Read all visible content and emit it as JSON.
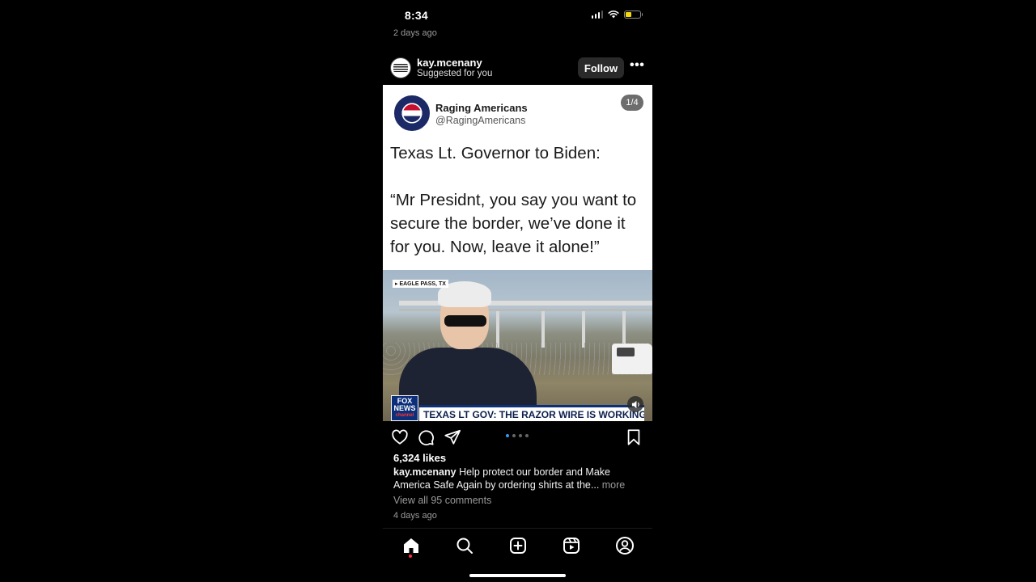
{
  "status_bar": {
    "time": "8:34",
    "battery_level": 0.4,
    "battery_color": "#f5d90a"
  },
  "previous_post": {
    "time": "2 days ago"
  },
  "post": {
    "username": "kay.mcenany",
    "subtitle": "Suggested for you",
    "follow_label": "Follow",
    "more_icon": "more-horizontal-icon",
    "media": {
      "page_indicator": "1/4",
      "tweet": {
        "name": "Raging Americans",
        "handle": "@RagingAmericans",
        "text_lines_1": [
          "Texas Lt. Governor to Biden:"
        ],
        "text_lines_2": [
          "“Mr Presidnt, you say you want to",
          "secure the border, we’ve done it",
          "for you. Now, leave it alone!”"
        ]
      },
      "video": {
        "location": "▸ EAGLE PASS, TX",
        "network_line1": "FOX",
        "network_line2": "NEWS",
        "network_line3": "channel",
        "chyron": "TEXAS LT GOV: THE RAZOR WIRE IS WORKING",
        "mute_icon": "speaker-icon"
      }
    },
    "actions": {
      "like_icon": "heart-icon",
      "comment_icon": "comment-icon",
      "share_icon": "send-icon",
      "save_icon": "bookmark-icon",
      "carousel_dots": 4,
      "carousel_active": 0,
      "accent_color": "#3897f0"
    },
    "likes": "6,324 likes",
    "caption": {
      "user": "kay.mcenany",
      "text": " Help protect our border and Make America Safe Again by ordering shirts at the...",
      "more": " more"
    },
    "view_comments": "View all 95 comments",
    "time": "4 days ago"
  },
  "bottom_nav": {
    "items": [
      {
        "icon": "home-icon",
        "active": true
      },
      {
        "icon": "search-icon",
        "active": false
      },
      {
        "icon": "create-post-icon",
        "active": false
      },
      {
        "icon": "reels-icon",
        "active": false
      },
      {
        "icon": "profile-icon",
        "active": false
      }
    ],
    "notification_color": "#ff3040"
  }
}
